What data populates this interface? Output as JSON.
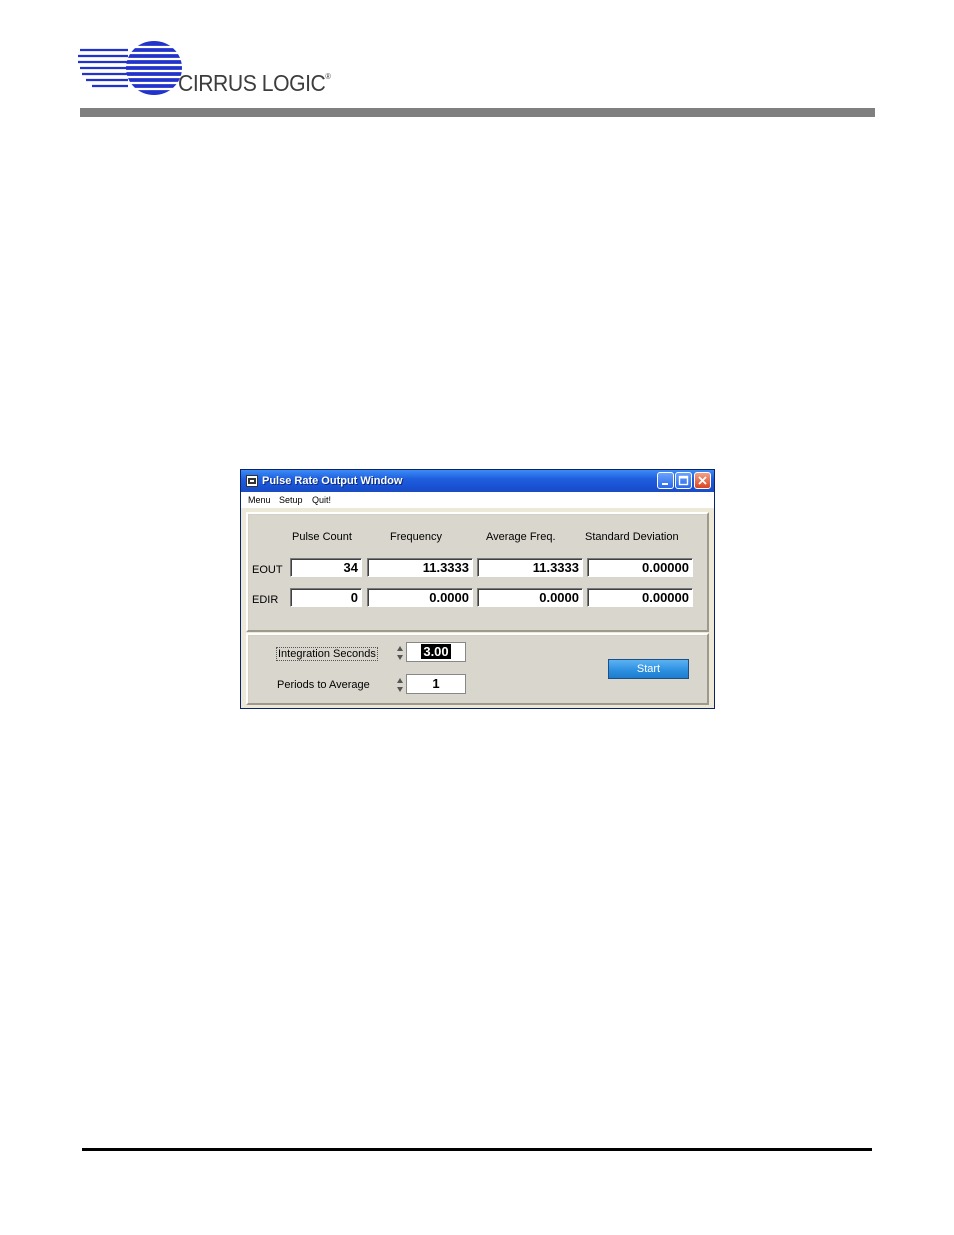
{
  "brand": {
    "name": "CIRRUS LOGIC",
    "trademark": "®",
    "color_text": "#3d3d3d",
    "color_logo": "#2233cc"
  },
  "window": {
    "title": "Pulse Rate Output Window",
    "menu": [
      "Menu",
      "Setup",
      "Quit!"
    ]
  },
  "table": {
    "columns": [
      "Pulse Count",
      "Frequency",
      "Average Freq.",
      "Standard Deviation"
    ],
    "rows": [
      {
        "label": "EOUT",
        "values": [
          "34",
          "11.3333",
          "11.3333",
          "0.00000"
        ]
      },
      {
        "label": "EDIR",
        "values": [
          "0",
          "0.0000",
          "0.0000",
          "0.00000"
        ]
      }
    ]
  },
  "controls": {
    "integration_label": "Integration Seconds",
    "integration_value": "3.00",
    "periods_label": "Periods to Average",
    "periods_value": "1",
    "start_label": "Start"
  }
}
